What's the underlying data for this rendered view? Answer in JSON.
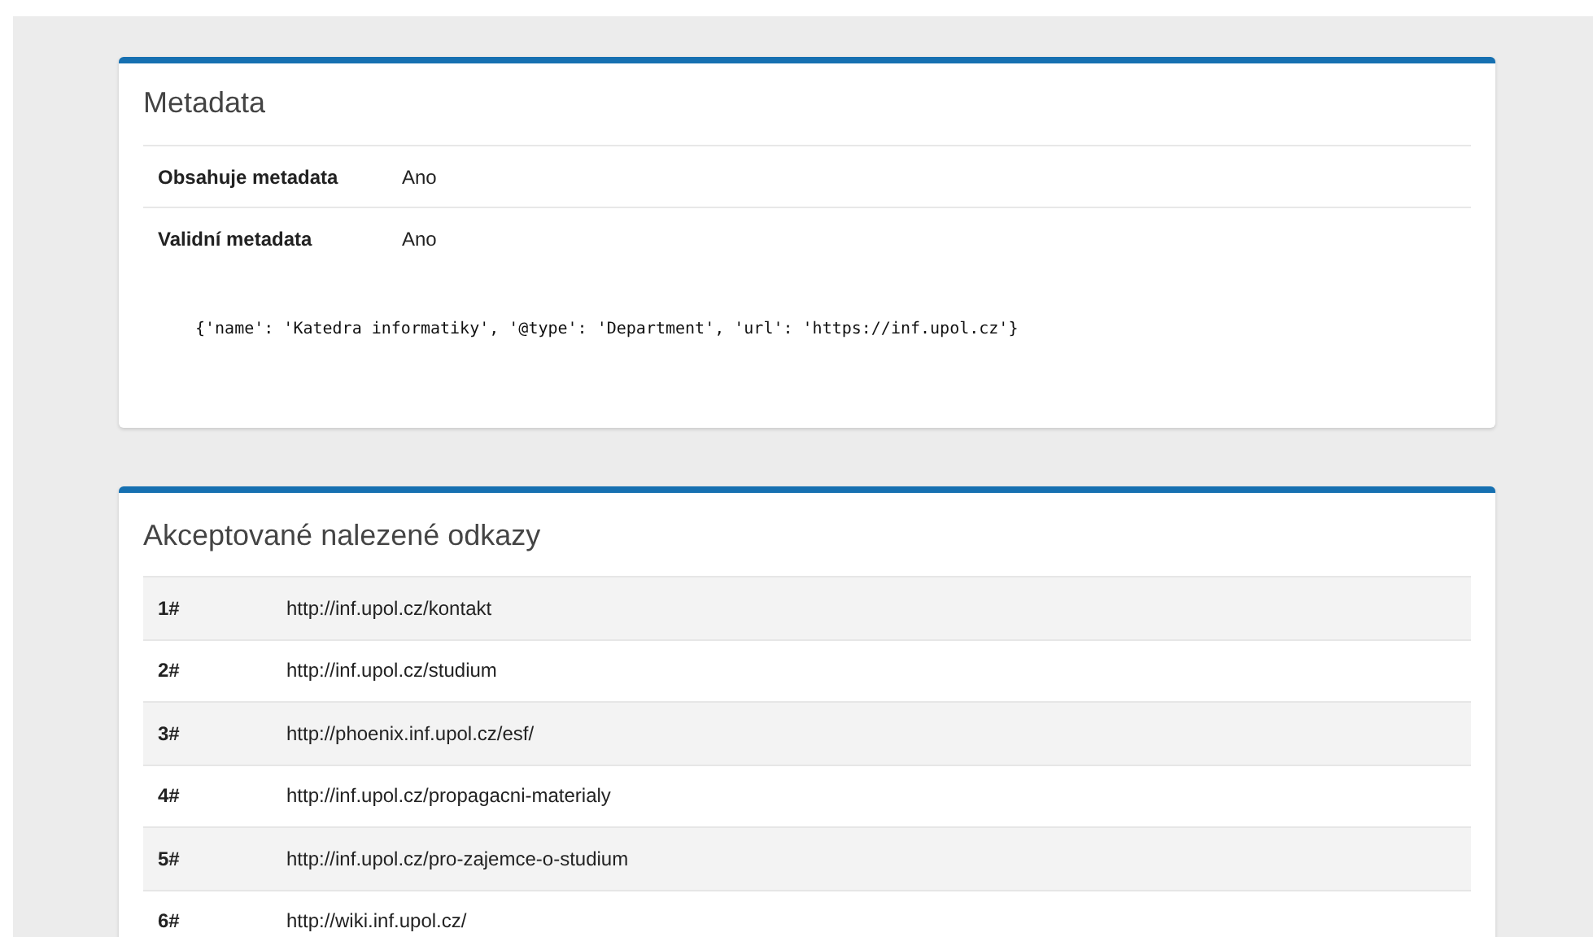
{
  "metadata_card": {
    "title": "Metadata",
    "rows": [
      {
        "label": "Obsahuje metadata",
        "value": "Ano"
      },
      {
        "label": "Validní metadata",
        "value": "Ano"
      }
    ],
    "code": "{'name': 'Katedra informatiky', '@type': 'Department', 'url': 'https://inf.upol.cz'}"
  },
  "links_card": {
    "title": "Akceptované nalezené odkazy",
    "rows": [
      {
        "index": "1#",
        "url": "http://inf.upol.cz/kontakt"
      },
      {
        "index": "2#",
        "url": "http://inf.upol.cz/studium"
      },
      {
        "index": "3#",
        "url": "http://phoenix.inf.upol.cz/esf/"
      },
      {
        "index": "4#",
        "url": "http://inf.upol.cz/propagacni-materialy"
      },
      {
        "index": "5#",
        "url": "http://inf.upol.cz/pro-zajemce-o-studium"
      },
      {
        "index": "6#",
        "url": "http://wiki.inf.upol.cz/"
      }
    ]
  }
}
